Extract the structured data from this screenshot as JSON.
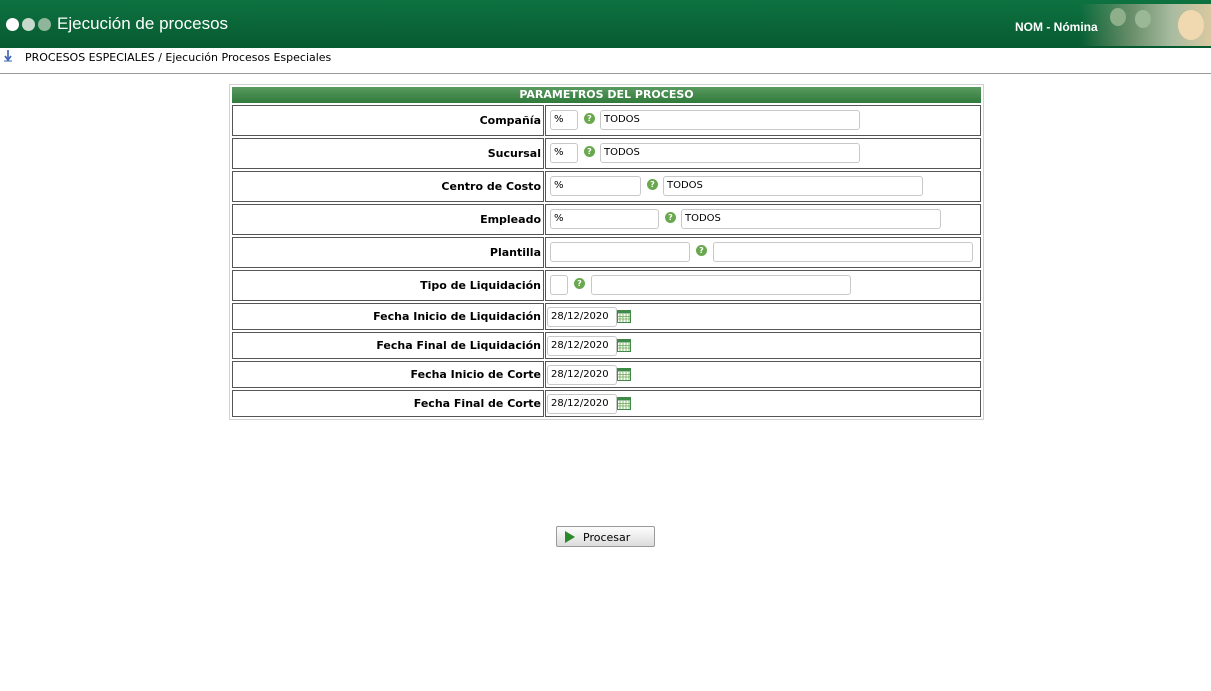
{
  "header": {
    "title": "Ejecución de procesos",
    "module": "NOM - Nómina",
    "dot_colors": [
      "#ffffff",
      "#c7d9cc",
      "#8fb69b"
    ]
  },
  "breadcrumb": {
    "text": "PROCESOS ESPECIALES / Ejecución Procesos Especiales",
    "icon": "info-arrow-icon"
  },
  "panel": {
    "title": "PARAMETROS DEL PROCESO",
    "fields": {
      "compania": {
        "label": "Compañía",
        "code": "%",
        "desc": "TODOS"
      },
      "sucursal": {
        "label": "Sucursal",
        "code": "%",
        "desc": "TODOS"
      },
      "centro_costo": {
        "label": "Centro de Costo",
        "code": "%",
        "desc": "TODOS"
      },
      "empleado": {
        "label": "Empleado",
        "code": "%",
        "desc": "TODOS"
      },
      "plantilla": {
        "label": "Plantilla",
        "code": "",
        "desc": ""
      },
      "tipo_liquidacion": {
        "label": "Tipo de Liquidación",
        "code": "",
        "desc": ""
      },
      "fecha_inicio_liq": {
        "label": "Fecha Inicio de Liquidación",
        "value": "28/12/2020"
      },
      "fecha_final_liq": {
        "label": "Fecha Final de Liquidación",
        "value": "28/12/2020"
      },
      "fecha_inicio_corte": {
        "label": "Fecha Inicio de Corte",
        "value": "28/12/2020"
      },
      "fecha_final_corte": {
        "label": "Fecha Final de Corte",
        "value": "28/12/2020"
      }
    },
    "help_icon": "help-icon",
    "calendar_icon": "calendar-icon"
  },
  "actions": {
    "process_label": "Procesar",
    "process_icon": "play-icon"
  },
  "colors": {
    "header_green": "#0b6b3a",
    "panel_header_green": "#3f8a47"
  }
}
